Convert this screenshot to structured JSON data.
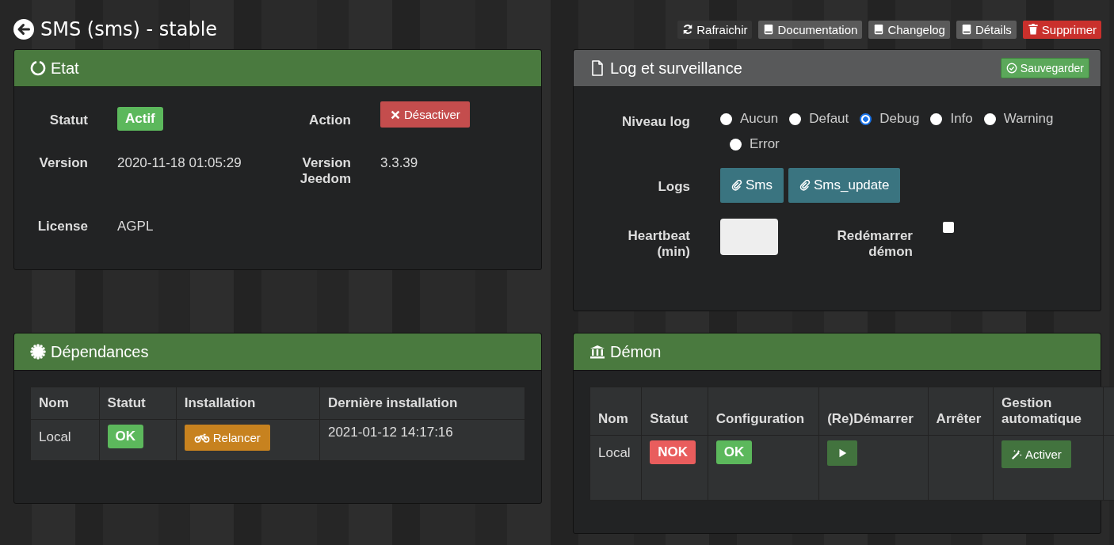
{
  "header": {
    "title": "SMS (sms) - stable",
    "buttons": [
      {
        "label": "Rafraichir",
        "kind": "refresh"
      },
      {
        "label": "Documentation",
        "kind": "book"
      },
      {
        "label": "Changelog",
        "kind": "book"
      },
      {
        "label": "Détails",
        "kind": "book"
      },
      {
        "label": "Supprimer",
        "kind": "delete"
      }
    ]
  },
  "etat": {
    "title": "Etat",
    "statut_label": "Statut",
    "statut": {
      "text": "Actif",
      "kind": "success"
    },
    "action_label": "Action",
    "action_button": "Désactiver",
    "version_label": "Version",
    "version": "2020-11-18 01:05:29",
    "jeedom_label": "Version Jeedom",
    "jeedom_version": "3.3.39",
    "license_label": "License",
    "license": "AGPL"
  },
  "log": {
    "title": "Log et surveillance",
    "save_button": "Sauvegarder",
    "level_label": "Niveau log",
    "levels": [
      {
        "label": "Aucun",
        "selected": false
      },
      {
        "label": "Defaut",
        "selected": false
      },
      {
        "label": "Debug",
        "selected": true
      },
      {
        "label": "Info",
        "selected": false
      },
      {
        "label": "Warning",
        "selected": false
      },
      {
        "label": "Error",
        "selected": false
      }
    ],
    "logs_label": "Logs",
    "log_buttons": [
      "Sms",
      "Sms_update"
    ],
    "heartbeat_label": "Heartbeat (min)",
    "restart_label": "Redémarrer démon",
    "restart_checked": false
  },
  "dependances": {
    "title": "Dépendances",
    "columns": [
      "Nom",
      "Statut",
      "Installation",
      "Dernière installation"
    ],
    "rows": [
      {
        "name": "Local",
        "status": {
          "text": "OK",
          "kind": "success"
        },
        "install_button": "Relancer",
        "last_install": "2021-01-12 14:17:16"
      }
    ]
  },
  "demon": {
    "title": "Démon",
    "columns": [
      "Nom",
      "Statut",
      "Configuration",
      "(Re)Démarrer",
      "Arrêter",
      "Gestion automatique"
    ],
    "rows": [
      {
        "name": "Local",
        "status": {
          "text": "NOK",
          "kind": "danger"
        },
        "config": {
          "text": "OK",
          "kind": "success"
        },
        "auto_button": "Activer"
      }
    ]
  }
}
